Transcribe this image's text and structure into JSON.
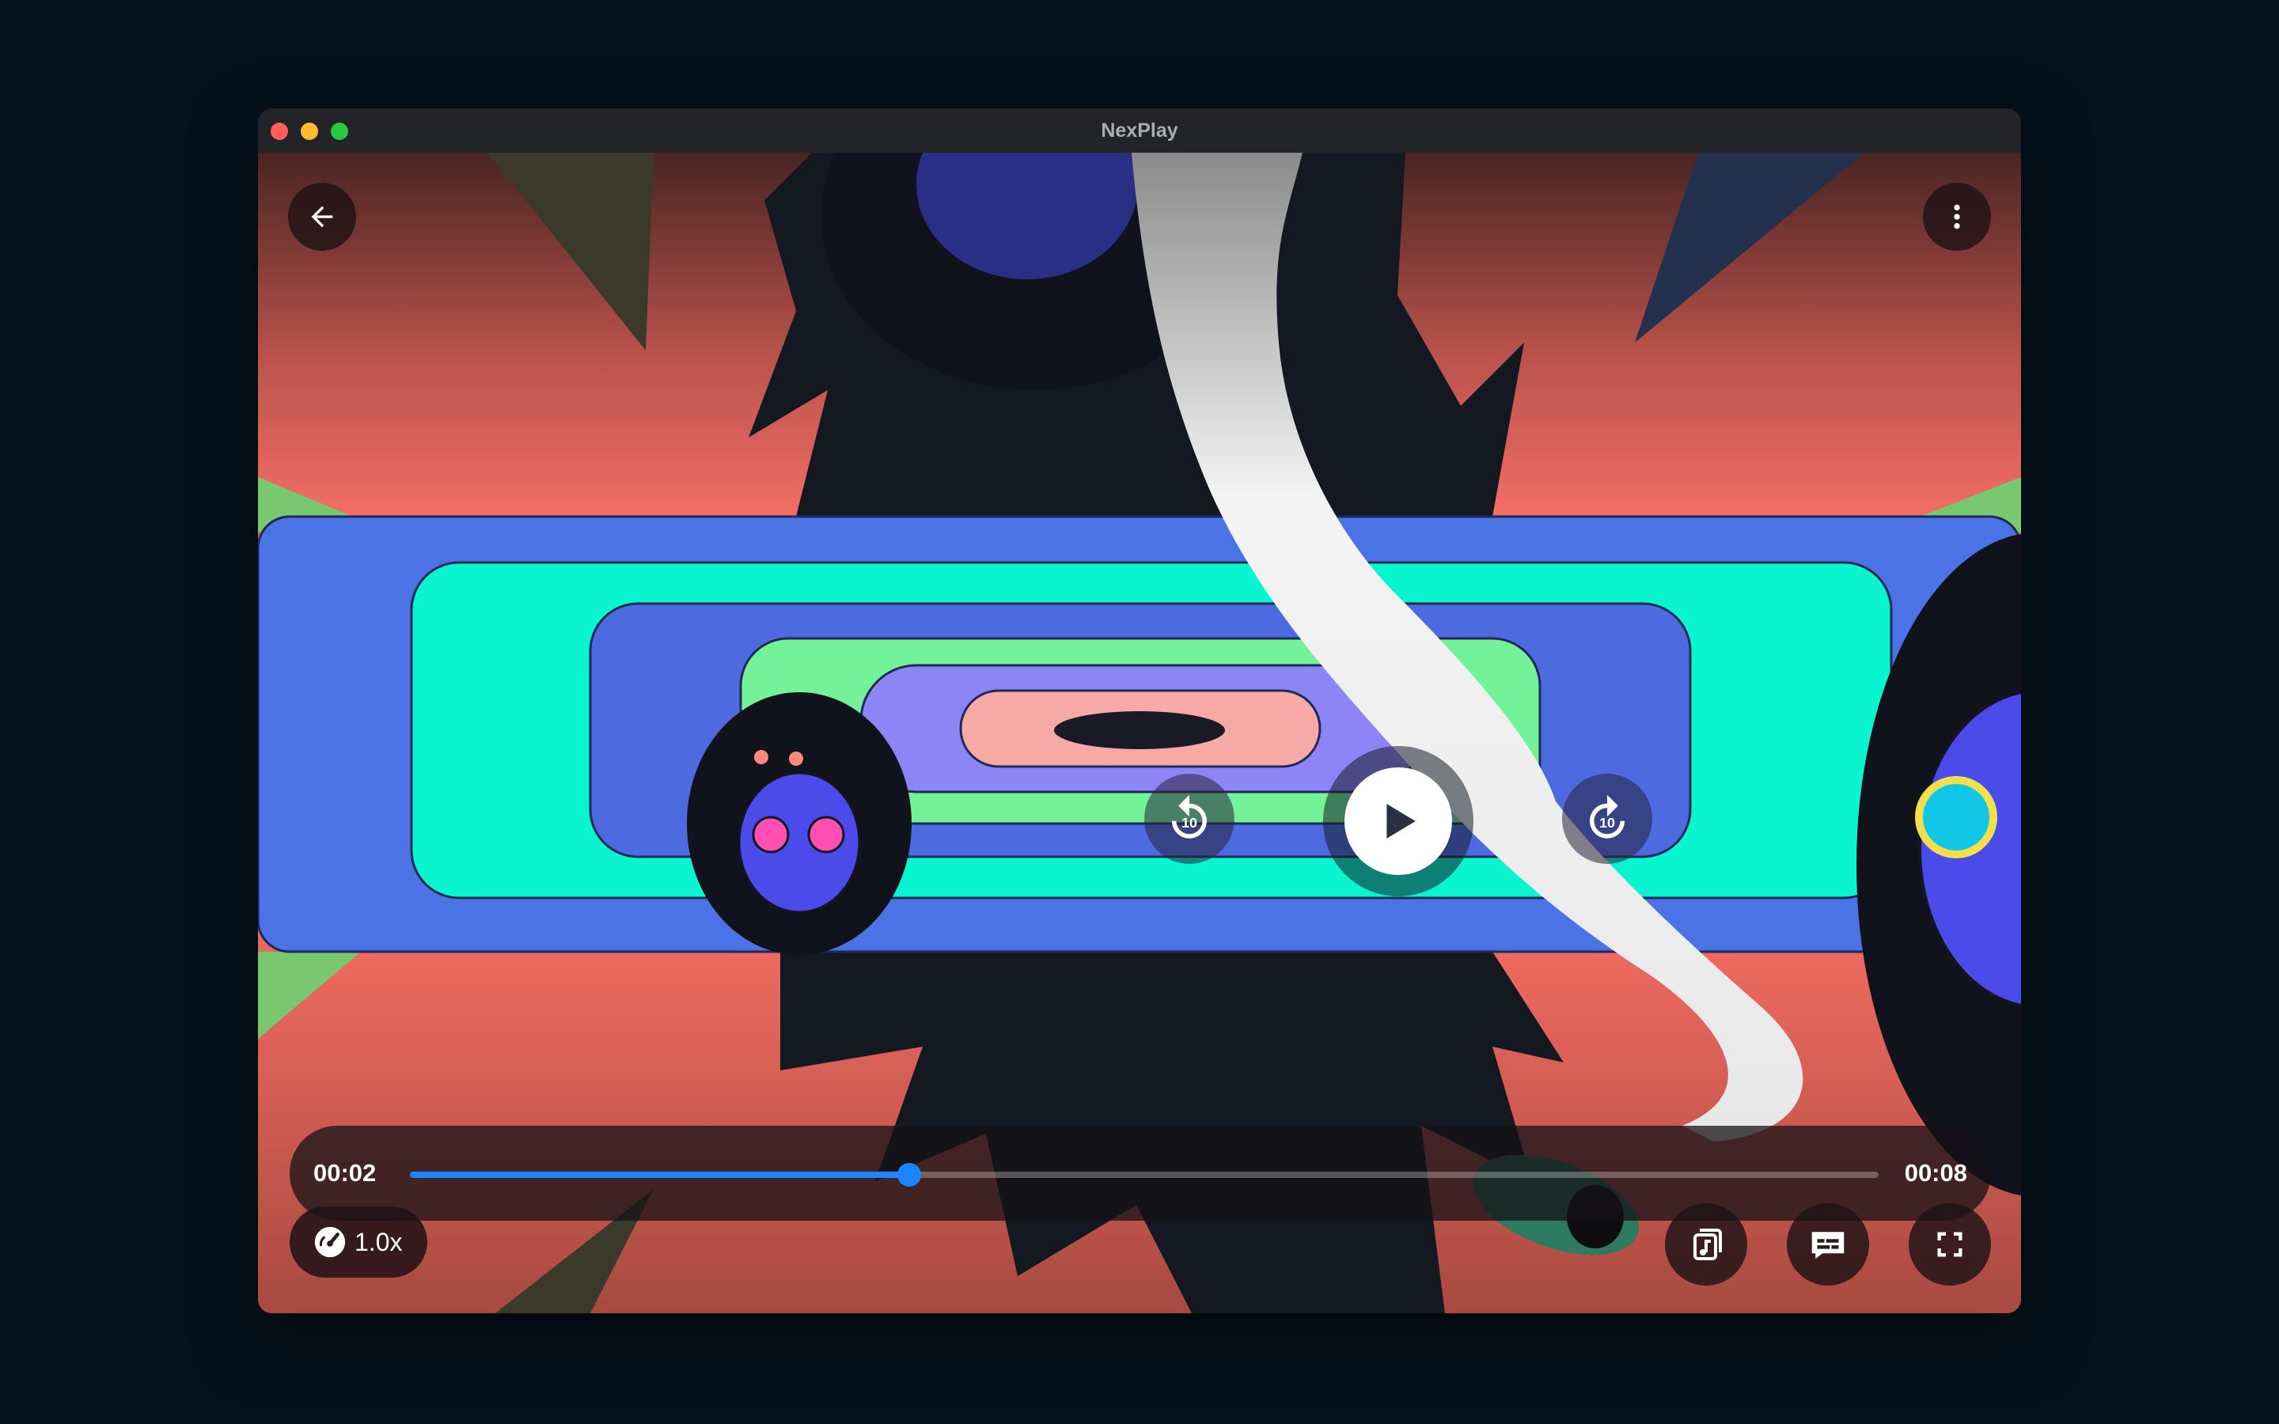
{
  "window": {
    "title": "NexPlay"
  },
  "player": {
    "current_time": "00:02",
    "duration": "00:08",
    "progress_fraction": 0.34,
    "speed": "1.0x",
    "skip_back_seconds": "10",
    "skip_forward_seconds": "10"
  },
  "icons": {
    "back": "arrow-left-icon",
    "more": "vertical-ellipsis-icon",
    "rewind": "replay-10-icon",
    "play": "play-icon",
    "forward": "forward-10-icon",
    "speed": "speedometer-icon",
    "audio_track": "audio-track-icon",
    "subtitles": "subtitles-icon",
    "fullscreen": "fullscreen-icon"
  },
  "colors": {
    "accent": "#1a85ff",
    "traffic_close": "#ff5f57",
    "traffic_minimize": "#febc2e",
    "traffic_zoom": "#28c840"
  }
}
